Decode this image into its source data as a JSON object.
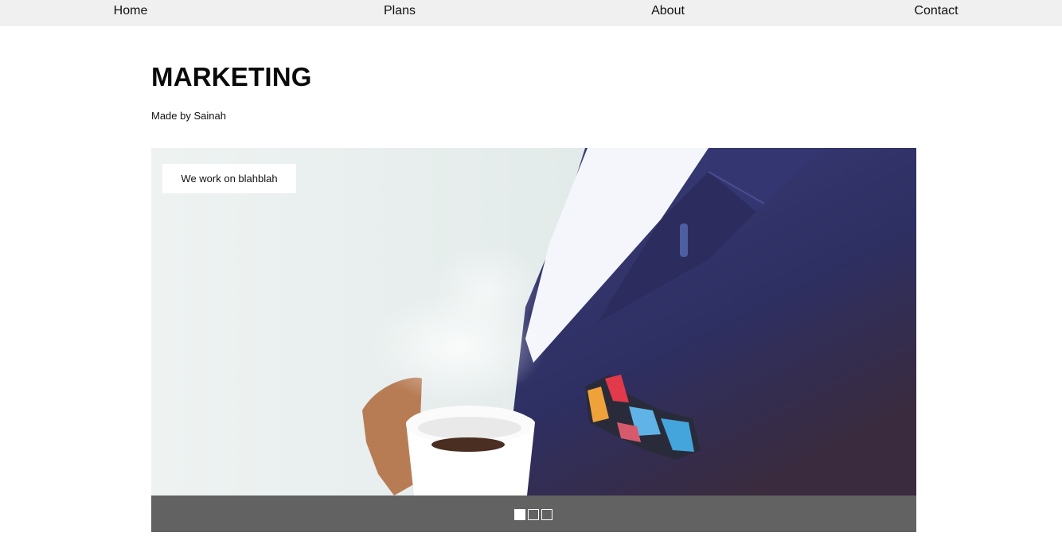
{
  "nav": {
    "items": [
      {
        "label": "Home"
      },
      {
        "label": "Plans"
      },
      {
        "label": "About"
      },
      {
        "label": "Contact"
      }
    ]
  },
  "header": {
    "title": "MARKETING",
    "byline": "Made by Sainah"
  },
  "slider": {
    "caption": "We work on blahblah",
    "slide_count": 3,
    "active_slide": 1,
    "image": "man in navy blazer holding steaming coffee cup, colorful pocket square"
  }
}
